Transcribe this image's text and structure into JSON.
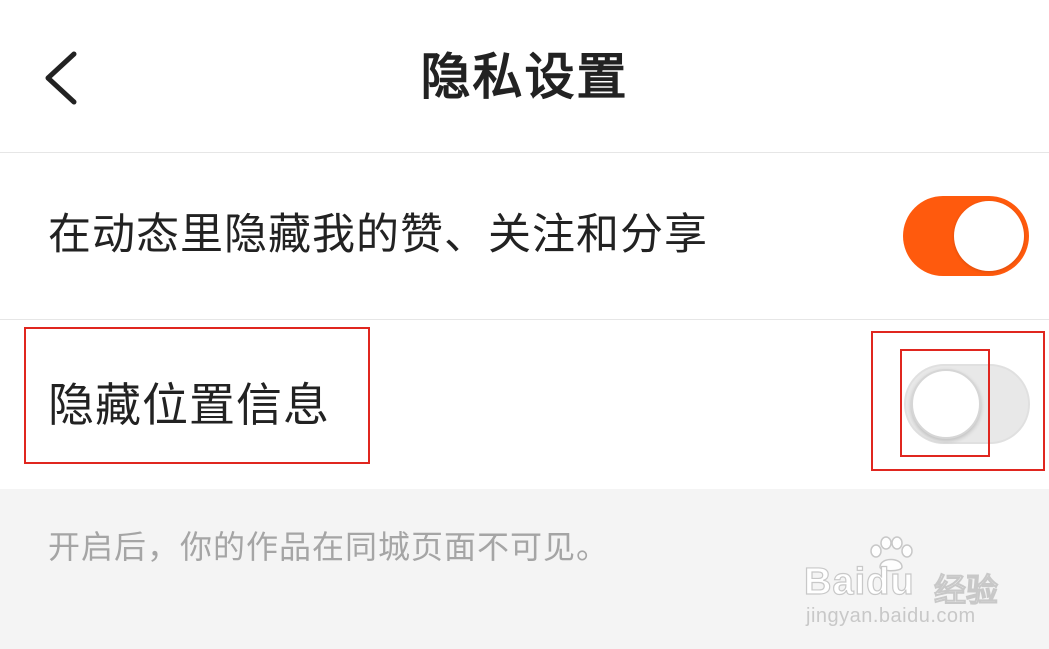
{
  "header": {
    "title": "隐私设置",
    "back_icon": "chevron-left-icon"
  },
  "settings": [
    {
      "label": "在动态里隐藏我的赞、关注和分享",
      "enabled": true
    },
    {
      "label": "隐藏位置信息",
      "enabled": false
    }
  ],
  "hint": {
    "text": "开启后，你的作品在同城页面不可见。"
  },
  "watermark": {
    "brand": "Baidu",
    "sub": "经验",
    "url": "jingyan.baidu.com"
  },
  "colors": {
    "accent": "#ff5a0d",
    "annotation": "#e0261f",
    "hint_bg": "#f4f4f4",
    "hint_text": "#a5a5a5",
    "toggle_off": "#e8e8e8"
  }
}
